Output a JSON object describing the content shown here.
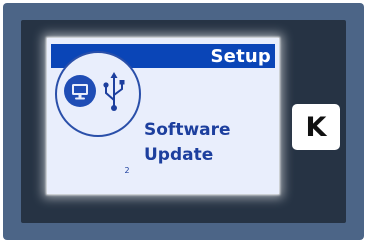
{
  "screen": {
    "title": "Setup",
    "subtitle_line1": "Software",
    "subtitle_line2": "Update",
    "page_number": "2",
    "icons": [
      "computer-monitor-icon",
      "usb-icon"
    ]
  },
  "key": {
    "label": "K"
  },
  "colors": {
    "panel": "#4c6587",
    "bezel": "#263344",
    "lcd_background": "#e9eefc",
    "lcd_header": "#0a45b7",
    "lcd_text": "#1d3f9e"
  }
}
